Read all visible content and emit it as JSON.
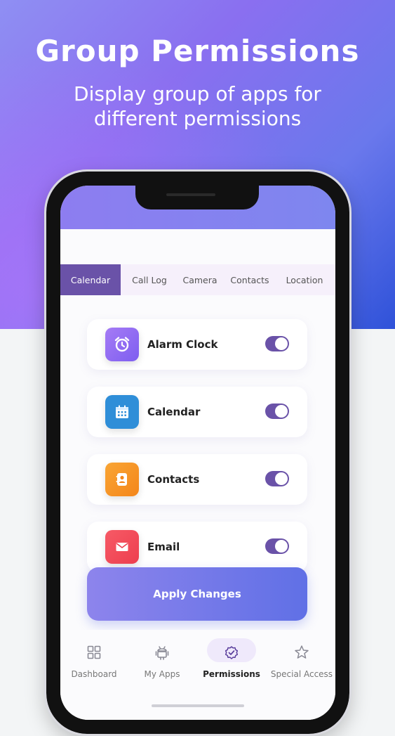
{
  "hero": {
    "title": "Group Permissions",
    "subtitle_line1": "Display group of apps for",
    "subtitle_line2": "different permissions"
  },
  "tabs": [
    {
      "label": "Calendar",
      "active": true
    },
    {
      "label": "Call Log",
      "active": false
    },
    {
      "label": "Camera",
      "active": false
    },
    {
      "label": "Contacts",
      "active": false
    },
    {
      "label": "Location",
      "active": false
    }
  ],
  "apps": [
    {
      "label": "Alarm Clock",
      "icon": "alarm-clock-icon",
      "color": "#9b6df2",
      "enabled": true
    },
    {
      "label": "Calendar",
      "icon": "calendar-icon",
      "color": "#2f8ed8",
      "enabled": true
    },
    {
      "label": "Contacts",
      "icon": "contacts-icon",
      "color": "#f7951f",
      "enabled": true
    },
    {
      "label": "Email",
      "icon": "email-icon",
      "color": "#f24c5a",
      "enabled": true
    }
  ],
  "apply_button": {
    "label": "Apply Changes"
  },
  "bottom_nav": [
    {
      "label": "Dashboard",
      "icon": "dashboard-icon",
      "active": false
    },
    {
      "label": "My Apps",
      "icon": "android-icon",
      "active": false
    },
    {
      "label": "Permissions",
      "icon": "shield-check-icon",
      "active": true
    },
    {
      "label": "Special Access",
      "icon": "star-icon",
      "active": false
    }
  ],
  "colors": {
    "accent": "#6a52a8",
    "hero_gradient_start": "#8f8ff3",
    "hero_gradient_end": "#2f52d9"
  }
}
